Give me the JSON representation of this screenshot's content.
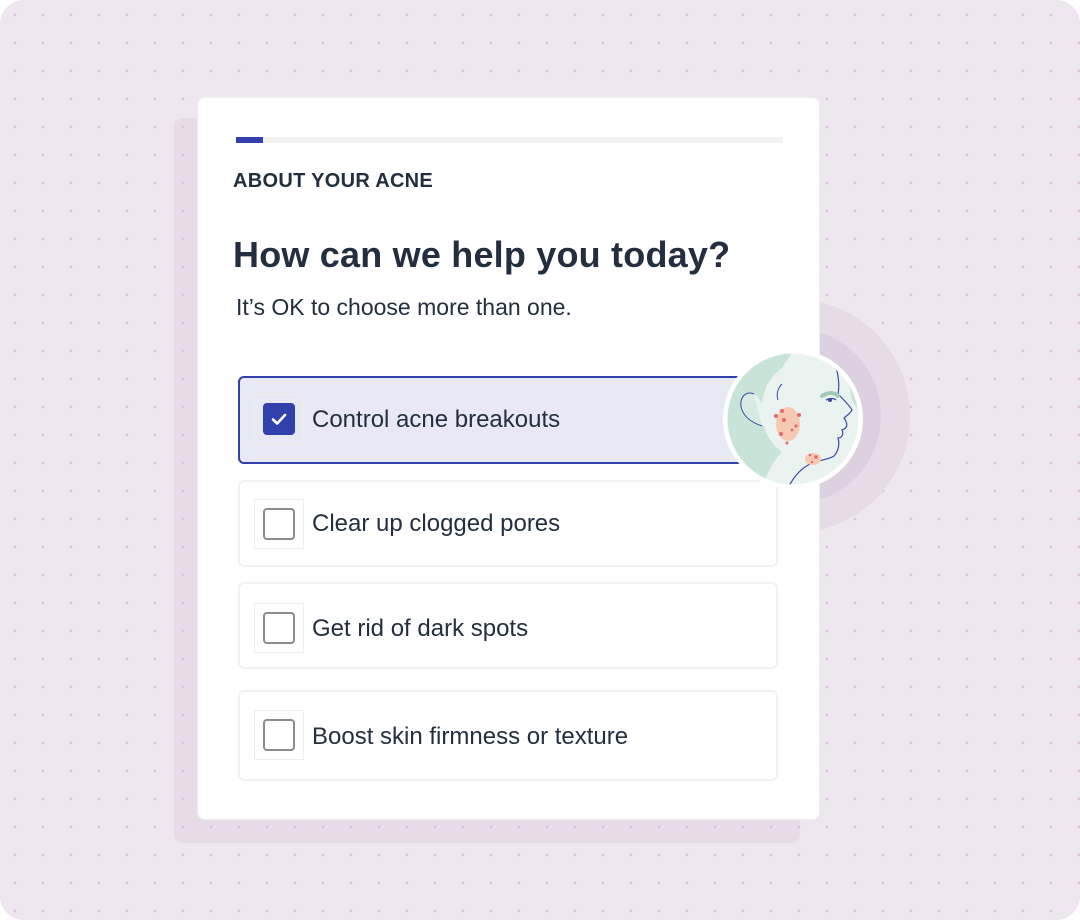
{
  "section": {
    "eyebrow": "ABOUT YOUR ACNE"
  },
  "progress": {
    "value_percent": 5,
    "fill_color": "#3140ad",
    "track_color": "#f3f2f2"
  },
  "question": {
    "title": "How can we help you today?",
    "subtitle": "It’s OK to choose more than one."
  },
  "options": [
    {
      "label": "Control acne breakouts",
      "checked": true
    },
    {
      "label": "Clear up clogged pores",
      "checked": false
    },
    {
      "label": "Get rid of dark spots",
      "checked": false
    },
    {
      "label": "Boost skin firmness or texture",
      "checked": false
    }
  ],
  "illustration": {
    "icon": "face-with-acne-illustration"
  },
  "colors": {
    "accent": "#3140ad",
    "selected_bg": "#e9e9f6",
    "text": "#232f3e",
    "background": "#efe7ef"
  }
}
